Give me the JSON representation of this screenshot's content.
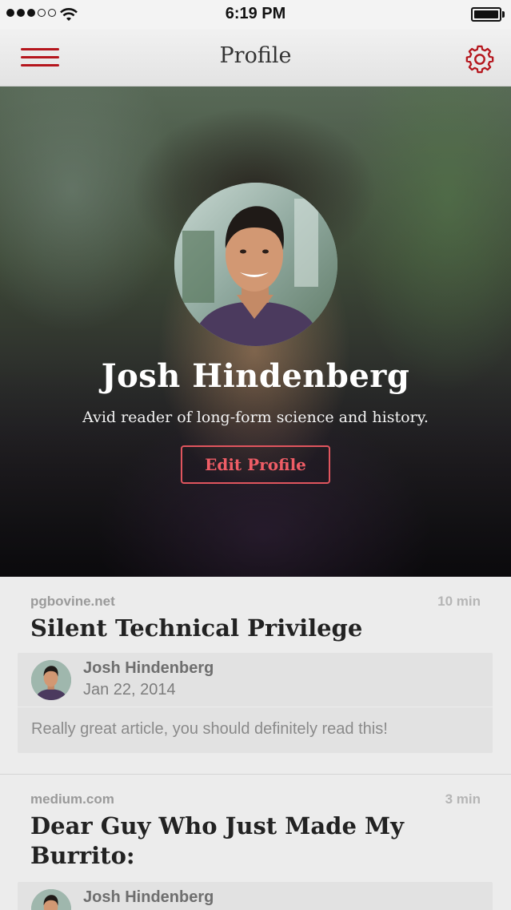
{
  "status_bar": {
    "time": "6:19 PM",
    "signal_bars_filled": 3,
    "signal_bars_total": 5,
    "wifi_icon": "wifi-icon",
    "battery_level": 1.0
  },
  "nav": {
    "title": "Profile",
    "menu_icon": "hamburger-menu-icon",
    "settings_icon": "gear-icon",
    "accent_color": "#b5161d"
  },
  "profile": {
    "name": "Josh Hindenberg",
    "bio": "Avid reader of long-form science and history.",
    "edit_button_label": "Edit Profile",
    "edit_button_color": "#ef5d66"
  },
  "feed": [
    {
      "source": "pgbovine.net",
      "read_time": "10 min",
      "title": "Silent Technical Privilege",
      "comment": {
        "author": "Josh Hindenberg",
        "date": "Jan 22, 2014",
        "text": "Really great article, you should definitely read this!"
      }
    },
    {
      "source": "medium.com",
      "read_time": "3 min",
      "title_line1": "Dear Guy Who Just Made My",
      "title_line2": "Burrito:",
      "comment": {
        "author": "Josh Hindenberg"
      }
    }
  ]
}
